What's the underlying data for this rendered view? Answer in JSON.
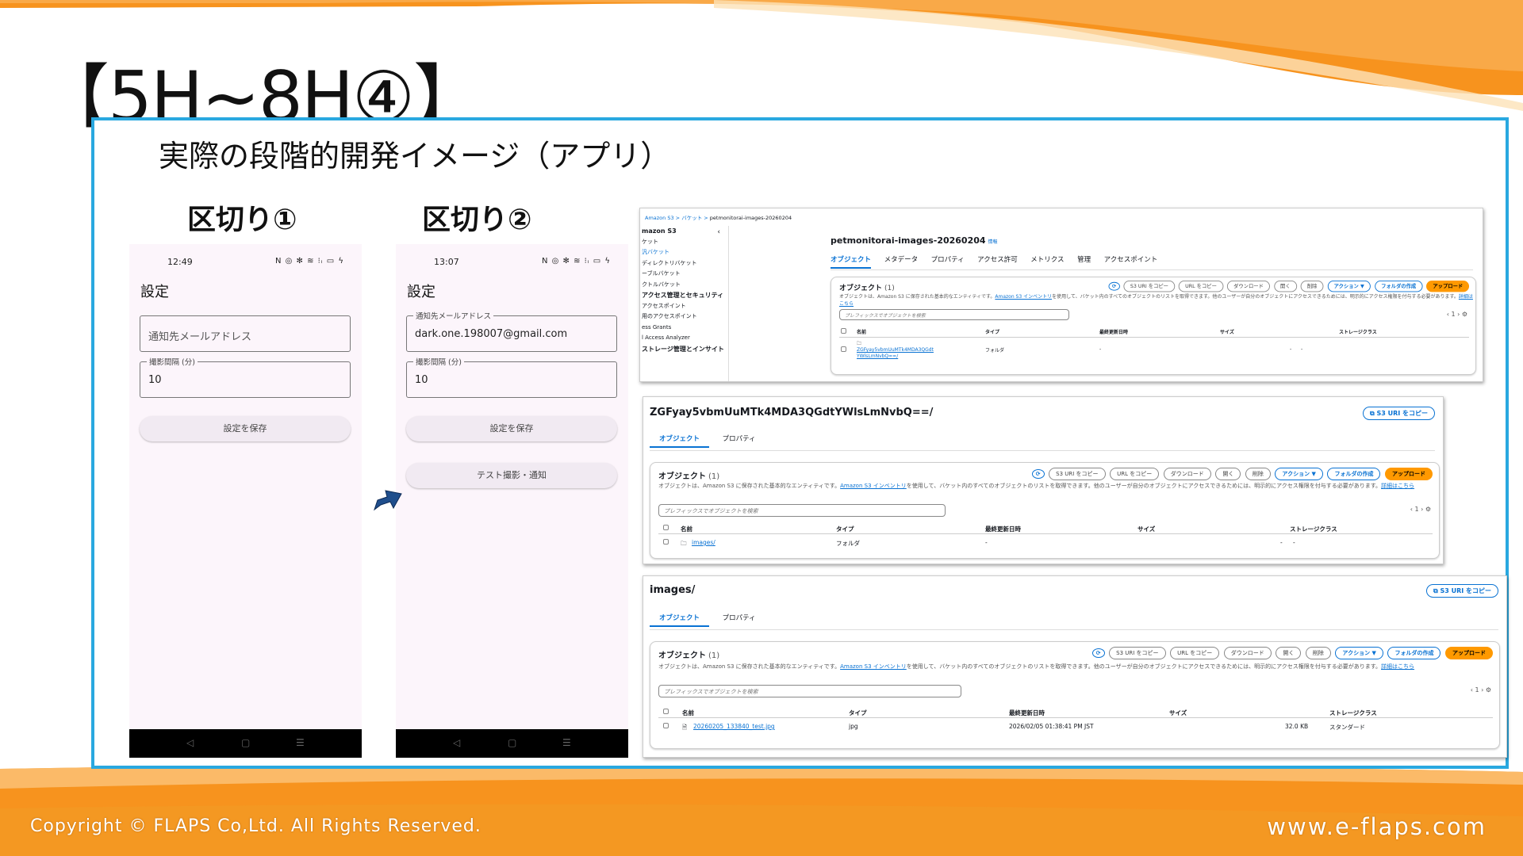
{
  "slide": {
    "title": "【5H~8H④】",
    "subtitle": "実際の段階的開発イメージ（アプリ）",
    "section1": "区切り①",
    "section2": "区切り②",
    "copyright": "Copyright © FLAPS Co,Ltd. All Rights Reserved.",
    "website": "www.e-flaps.com",
    "colors": {
      "frame": "#29a8e0",
      "accent": "#f7931e",
      "arrow": "#1f4e8c"
    }
  },
  "phone1": {
    "time": "12:49",
    "status_icons": "N ◎ ✻ ≋ ⁝ᵢ ▭ ϟ",
    "title": "設定",
    "email_placeholder": "通知先メールアドレス",
    "interval_label": "撮影間隔 (分)",
    "interval_value": "10",
    "save_button": "設定を保存",
    "nav": {
      "back": "◁",
      "home": "▢",
      "menu": "☰"
    }
  },
  "phone2": {
    "time": "13:07",
    "status_icons": "N ◎ ✻ ≋ ⁝ᵢ ▭ ϟ",
    "title": "設定",
    "email_label": "通知先メールアドレス",
    "email_value": "dark.one.198007@gmail.com",
    "interval_label": "撮影間隔 (分)",
    "interval_value": "10",
    "save_button": "設定を保存",
    "test_button": "テスト撮影・通知",
    "nav": {
      "back": "◁",
      "home": "▢",
      "menu": "☰"
    }
  },
  "aws1": {
    "breadcrumb": {
      "a": "Amazon S3",
      "b": "バケット",
      "c": "petmonitorai-images-20260204"
    },
    "sidebar": {
      "header": "mazon S3",
      "items": [
        "ケット",
        "汎バケット",
        "ディレクトリバケット",
        "ーブルバケット",
        "クトルバケット",
        "アクセス管理とセキュリティ",
        "アクセスポイント",
        "用のアクセスポイント",
        "ess Grants",
        "l Access Analyzer",
        "ストレージ管理とインサイト"
      ]
    },
    "bucket_name": "petmonitorai-images-20260204",
    "info": "情報",
    "tabs": [
      "オブジェクト",
      "メタデータ",
      "プロパティ",
      "アクセス許可",
      "メトリクス",
      "管理",
      "アクセスポイント"
    ],
    "panel_title": "オブジェクト",
    "count": "(1)",
    "desc1": "オブジェクトは、Amazon S3 に保存された基本的なエンティティです。",
    "desc_link": "Amazon S3 インベントリ",
    "desc2": "を使用して、バケット内のすべてのオブジェクトのリストを取得できます。他のユーザーが自分のオブジェクトにアクセスできるためには、明示的にアクセス権限を付与する必要があります。",
    "desc_more": "詳細はこちら",
    "search_placeholder": "プレフィックスでオブジェクトを検索",
    "page": "1",
    "columns": [
      "名前",
      "タイプ",
      "最終更新日時",
      "サイズ",
      "ストレージクラス"
    ],
    "row": {
      "name": "ZGFyay5vbmUuMTk4MDA3QGdtYWlsLmNvbQ==/",
      "type": "フォルダ",
      "modified": "-",
      "size": "-",
      "class": "-"
    }
  },
  "aws2": {
    "title": "ZGFyay5vbmUuMTk4MDA3QGdtYWlsLmNvbQ==/",
    "copy_uri": "S3 URI をコピー",
    "tabs": [
      "オブジェクト",
      "プロパティ"
    ],
    "panel_title": "オブジェクト",
    "count": "(1)",
    "desc1": "オブジェクトは、Amazon S3 に保存された基本的なエンティティです。",
    "desc_link": "Amazon S3 インベントリ",
    "desc2": "を使用して、バケット内のすべてのオブジェクトのリストを取得できます。他のユーザーが自分のオブジェクトにアクセスできるためには、明示的にアクセス権限を付与する必要があります。",
    "desc_more": "詳細はこちら",
    "search_placeholder": "プレフィックスでオブジェクトを検索",
    "page": "1",
    "columns": [
      "名前",
      "タイプ",
      "最終更新日時",
      "サイズ",
      "ストレージクラス"
    ],
    "row": {
      "name": "images/",
      "type": "フォルダ",
      "modified": "-",
      "size": "-",
      "class": "-"
    }
  },
  "aws3": {
    "title": "images/",
    "copy_uri": "S3 URI をコピー",
    "tabs": [
      "オブジェクト",
      "プロパティ"
    ],
    "panel_title": "オブジェクト",
    "count": "(1)",
    "desc1": "オブジェクトは、Amazon S3 に保存された基本的なエンティティです。",
    "desc_link": "Amazon S3 インベントリ",
    "desc2": "を使用して、バケット内のすべてのオブジェクトのリストを取得できます。他のユーザーが自分のオブジェクトにアクセスできるためには、明示的にアクセス権限を付与する必要があります。",
    "desc_more": "詳細はこちら",
    "search_placeholder": "プレフィックスでオブジェクトを検索",
    "page": "1",
    "columns": [
      "名前",
      "タイプ",
      "最終更新日時",
      "サイズ",
      "ストレージクラス"
    ],
    "row": {
      "name": "20260205_133840_test.jpg",
      "type": "jpg",
      "modified": "2026/02/05 01:38:41 PM JST",
      "size": "32.0 KB",
      "class": "スタンダード"
    }
  },
  "buttons": {
    "copy_s3": "S3 URI をコピー",
    "copy_url": "URL をコピー",
    "download": "ダウンロード",
    "open": "開く",
    "delete": "削除",
    "actions": "アクション ▼",
    "create_folder": "フォルダの作成",
    "upload": "アップロード"
  }
}
